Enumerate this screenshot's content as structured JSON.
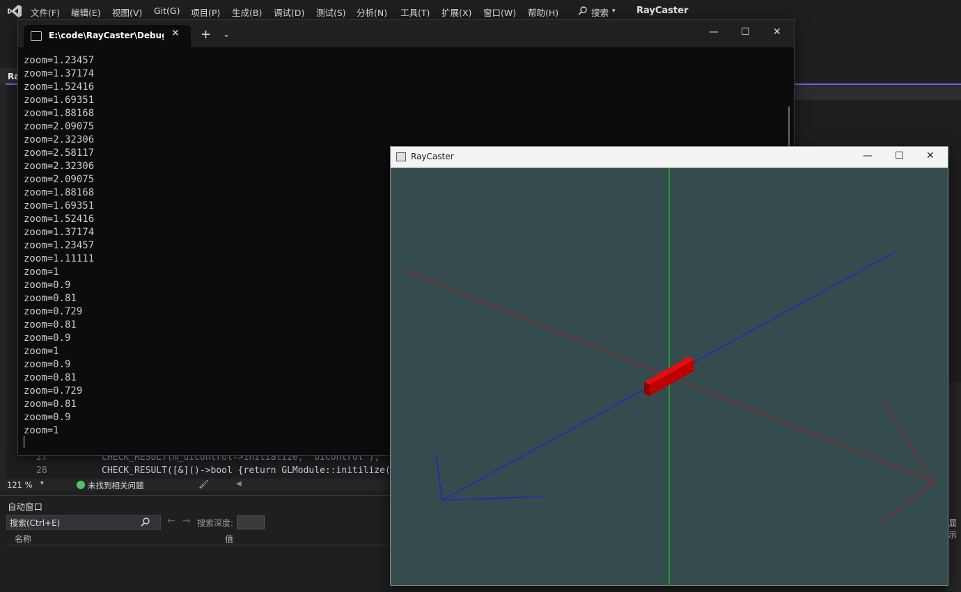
{
  "vs": {
    "menu": [
      "文件(F)",
      "编辑(E)",
      "视图(V)",
      "Git(G)",
      "项目(P)",
      "生成(B)",
      "调试(D)",
      "测试(S)",
      "分析(N)",
      "工具(T)",
      "扩展(X)",
      "窗口(W)",
      "帮助(H)"
    ],
    "search_label": "搜索",
    "solution_title": "RayCaster",
    "tab_label": "Ra",
    "zoom": "121 %",
    "issues": "未找到相关问题",
    "right_label": "显示",
    "code": {
      "line_27_num": "27",
      "line_27": "CHECK_RESULT(m_uicontrol->initialize, \"UIControl\");",
      "line_28_num": "28",
      "line_28": "CHECK_RESULT([&]()->bool {return GLModule::initilize("
    },
    "autos": {
      "title": "自动窗口",
      "search_placeholder": "搜索(Ctrl+E)",
      "search_depth": "搜索深度:",
      "col_name": "名称",
      "col_value": "值"
    }
  },
  "terminal": {
    "tab_title": "E:\\code\\RayCaster\\Debug\\Ray",
    "lines": [
      "zoom=1.23457",
      "zoom=1.37174",
      "zoom=1.52416",
      "zoom=1.69351",
      "zoom=1.88168",
      "zoom=2.09075",
      "zoom=2.32306",
      "zoom=2.58117",
      "zoom=2.32306",
      "zoom=2.09075",
      "zoom=1.88168",
      "zoom=1.69351",
      "zoom=1.52416",
      "zoom=1.37174",
      "zoom=1.23457",
      "zoom=1.11111",
      "zoom=1",
      "zoom=0.9",
      "zoom=0.81",
      "zoom=0.729",
      "zoom=0.81",
      "zoom=0.9",
      "zoom=1",
      "zoom=0.9",
      "zoom=0.81",
      "zoom=0.729",
      "zoom=0.81",
      "zoom=0.9",
      "zoom=1"
    ]
  },
  "raycaster": {
    "title": "RayCaster",
    "canvas_bg": "#344c4d",
    "colors": {
      "x_axis": "#a52020",
      "y_axis": "#22dd22",
      "z_axis": "#1c1ce0",
      "box": "#cc0000"
    }
  }
}
